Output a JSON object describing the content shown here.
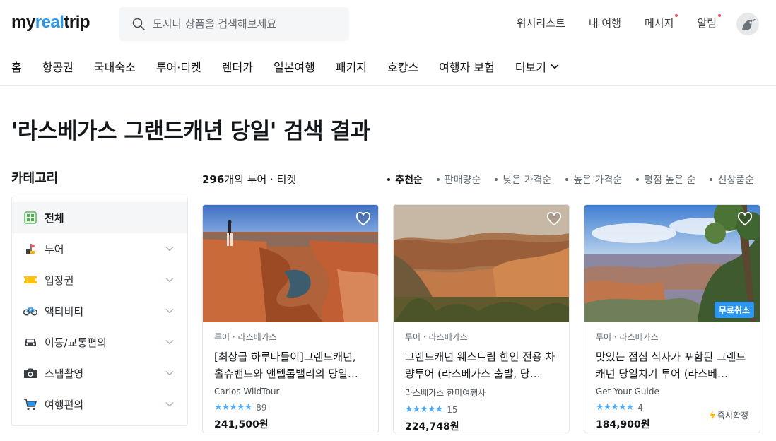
{
  "brand": {
    "logo_part1": "my",
    "logo_part2": "real",
    "logo_part3": "trip",
    "accent": "#2b96ed"
  },
  "search": {
    "placeholder": "도시나 상품을 검색해보세요"
  },
  "top_links": [
    "위시리스트",
    "내 여행",
    "메시지",
    "알림"
  ],
  "nav": [
    "홈",
    "항공권",
    "국내숙소",
    "투어·티켓",
    "렌터카",
    "일본여행",
    "패키지",
    "호캉스",
    "여행자 보험",
    "더보기"
  ],
  "page_title": "'라스베가스 그랜드캐년 당일' 검색 결과",
  "sidebar": {
    "title": "카테고리",
    "items": [
      {
        "label": "전체",
        "icon": "grid-icon"
      },
      {
        "label": "투어",
        "icon": "flag-icon"
      },
      {
        "label": "입장권",
        "icon": "ticket-icon"
      },
      {
        "label": "액티비티",
        "icon": "bicycle-icon"
      },
      {
        "label": "이동/교통편의",
        "icon": "car-icon"
      },
      {
        "label": "스냅촬영",
        "icon": "camera-icon"
      },
      {
        "label": "여행편의",
        "icon": "cart-icon"
      }
    ]
  },
  "results": {
    "count": "296",
    "count_suffix": "개의 투어 · 티켓"
  },
  "sorts": [
    "추천순",
    "판매량순",
    "낮은 가격순",
    "높은 가격순",
    "평점 높은 순",
    "신상품순"
  ],
  "cards": [
    {
      "meta": "투어 · 라스베가스",
      "title": "[최상급 하루나들이]그랜드캐년, 홀슈밴드와 앤텔롭밸리의 당일…",
      "seller": "Carlos WildTour",
      "stars": "★★★★★",
      "reviews": "89",
      "price": "241,500원"
    },
    {
      "meta": "투어 · 라스베가스",
      "title": "그랜드캐년 웨스트림 한인 전용 차량투어 (라스베가스 출발, 당…",
      "seller": "라스베가스 한미여행사",
      "stars": "★★★★★",
      "reviews": "15",
      "price": "224,748원"
    },
    {
      "meta": "투어 · 라스베가스",
      "title": "맛있는 점심 식사가 포함된 그랜드캐년 당일치기 투어 (라스베…",
      "seller": "Get Your Guide",
      "stars": "★★★★★",
      "reviews": "4",
      "price": "184,900원",
      "badge": "무료취소",
      "instant": "즉시확정"
    }
  ]
}
